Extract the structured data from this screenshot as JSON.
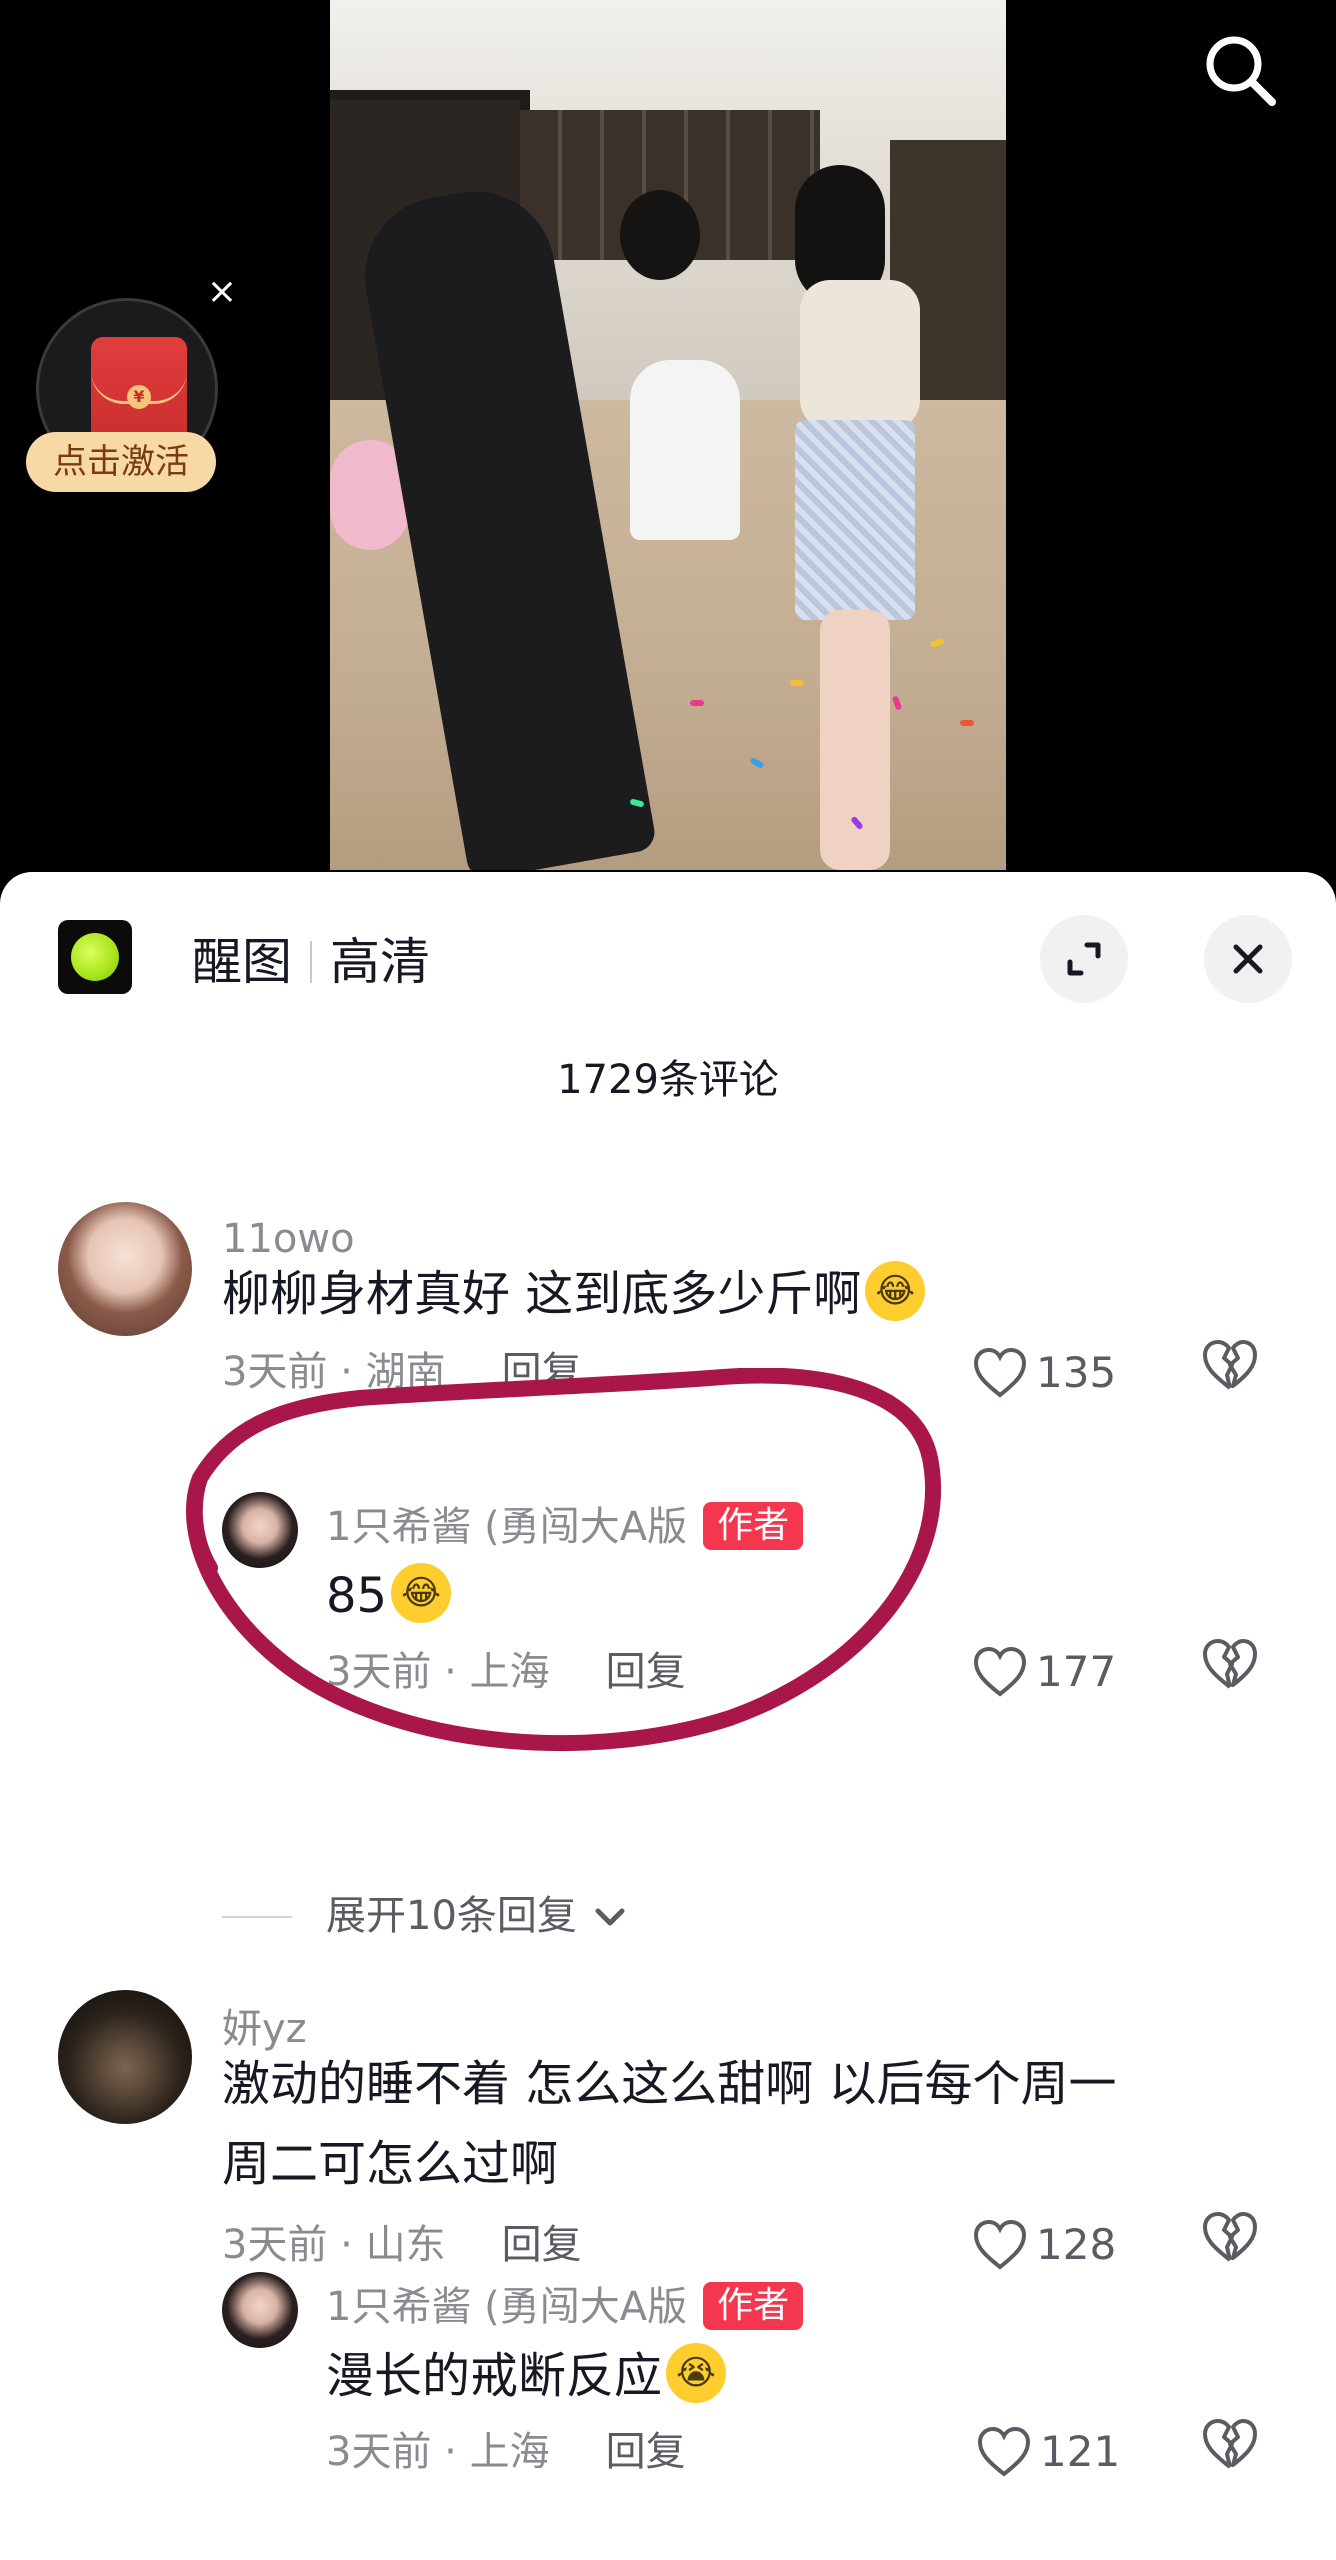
{
  "app": {
    "name": "醒图",
    "quality": "高清"
  },
  "redpacket": {
    "label": "点击激活",
    "coin": "¥",
    "close": "×"
  },
  "comment_count": "1729条评论",
  "comments": [
    {
      "username": "11owo",
      "text": "柳柳身材真好 这到底多少斤啊",
      "emoji": "😂",
      "time_location": "3天前 · 湖南",
      "reply_label": "回复",
      "likes": "135",
      "replies": [
        {
          "username": "1只希酱 (勇闯大A版",
          "badge": "作者",
          "text": "85",
          "emoji": "😂",
          "time_location": "3天前 · 上海",
          "reply_label": "回复",
          "likes": "177"
        }
      ],
      "expand_label": "展开10条回复"
    },
    {
      "username": "妍yz",
      "text_line1": "激动的睡不着 怎么这么甜啊 以后每个周一",
      "text_line2": "周二可怎么过啊",
      "time_location": "3天前 · 山东",
      "reply_label": "回复",
      "likes": "128",
      "replies": [
        {
          "username": "1只希酱 (勇闯大A版",
          "badge": "作者",
          "text": "漫长的戒断反应",
          "emoji": "😭",
          "time_location": "3天前 · 上海",
          "reply_label": "回复",
          "likes": "121"
        }
      ]
    }
  ],
  "colors": {
    "annotation": "#a8164a",
    "author_badge": "#f4364e",
    "secondary_text": "#8a8b91"
  },
  "icons": {
    "search": "search-icon",
    "expand": "expand-icon",
    "close": "close-icon",
    "like": "heart-icon",
    "dislike": "broken-heart-icon"
  }
}
